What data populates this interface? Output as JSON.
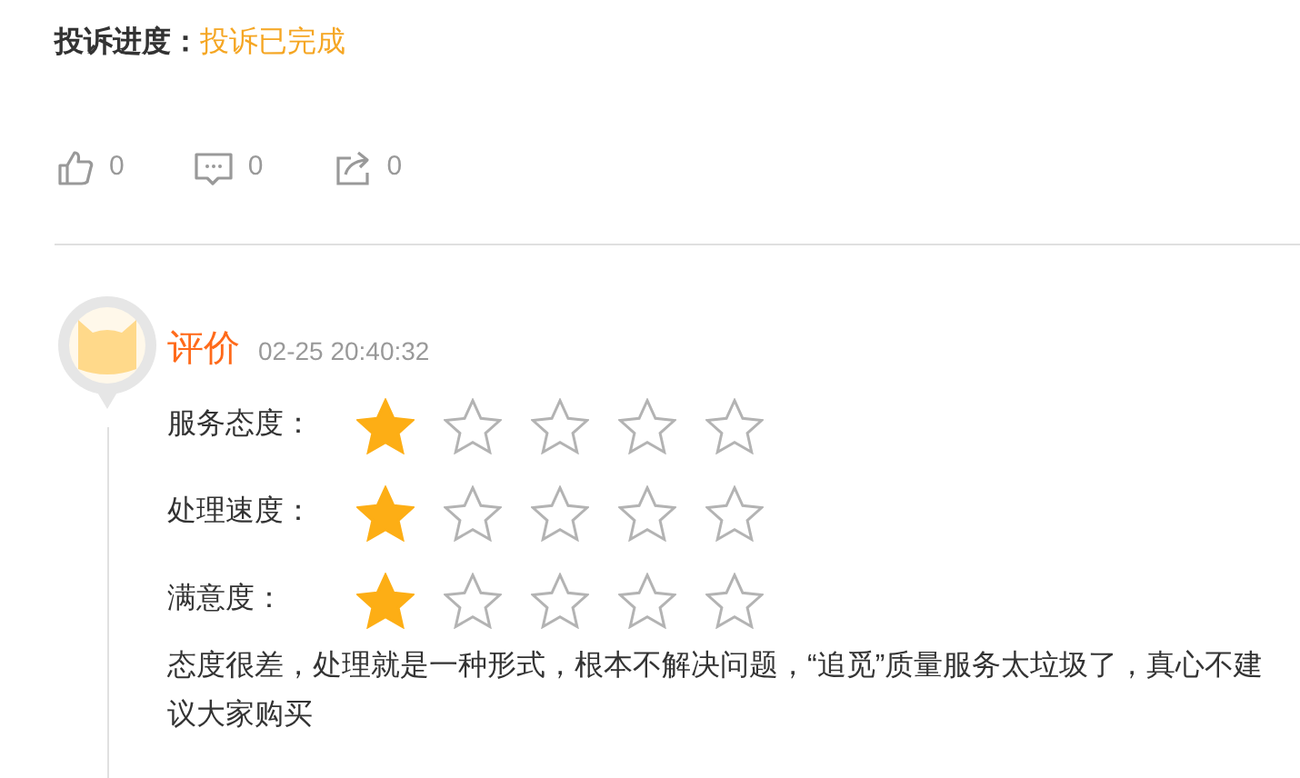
{
  "progress": {
    "label": "投诉进度：",
    "value": "投诉已完成"
  },
  "actions": [
    {
      "kind": "like",
      "count": "0"
    },
    {
      "kind": "comment",
      "count": "0"
    },
    {
      "kind": "share",
      "count": "0"
    }
  ],
  "review": {
    "title": "评价",
    "time": "02-25 20:40:32",
    "ratings": [
      {
        "label": "服务态度：",
        "stars": 1
      },
      {
        "label": "处理速度：",
        "stars": 1
      },
      {
        "label": "满意度：",
        "stars": 1
      }
    ],
    "comment": "态度很差，处理就是一种形式，根本不解决问题，“追觅”质量服务太垃圾了，真心不建议大家购买"
  }
}
